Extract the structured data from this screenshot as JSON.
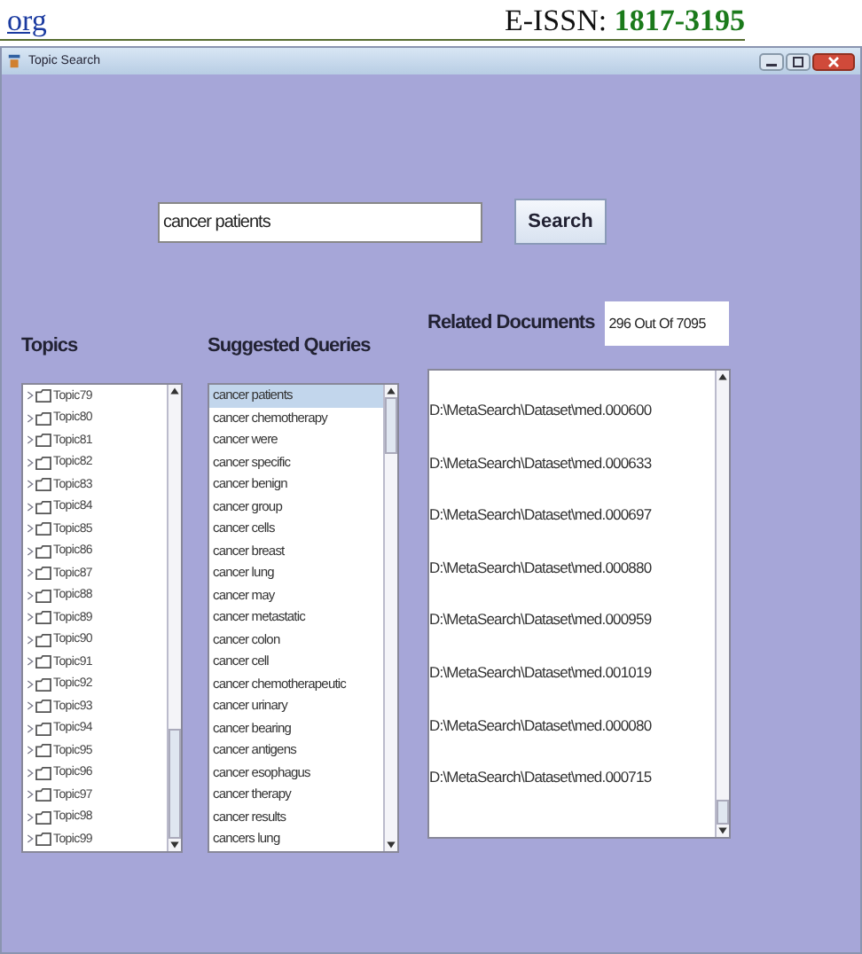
{
  "page_header": {
    "link": "org",
    "issn_label": "E-ISSN: ",
    "issn_number": "1817-3195"
  },
  "window": {
    "title": "Topic Search"
  },
  "search": {
    "value": "cancer patients",
    "button": "Search"
  },
  "topics": {
    "heading": "Topics",
    "items": [
      "Topic79",
      "Topic80",
      "Topic81",
      "Topic82",
      "Topic83",
      "Topic84",
      "Topic85",
      "Topic86",
      "Topic87",
      "Topic88",
      "Topic89",
      "Topic90",
      "Topic91",
      "Topic92",
      "Topic93",
      "Topic94",
      "Topic95",
      "Topic96",
      "Topic97",
      "Topic98",
      "Topic99"
    ]
  },
  "suggested_queries": {
    "heading": "Suggested Queries",
    "items": [
      {
        "text": "cancer patients",
        "selected": true
      },
      {
        "text": "cancer chemotherapy",
        "selected": false
      },
      {
        "text": "cancer were",
        "selected": false
      },
      {
        "text": "cancer specific",
        "selected": false
      },
      {
        "text": "cancer benign",
        "selected": false
      },
      {
        "text": "cancer group",
        "selected": false
      },
      {
        "text": "cancer cells",
        "selected": false
      },
      {
        "text": "cancer breast",
        "selected": false
      },
      {
        "text": "cancer lung",
        "selected": false
      },
      {
        "text": "cancer may",
        "selected": false
      },
      {
        "text": "cancer metastatic",
        "selected": false
      },
      {
        "text": "cancer colon",
        "selected": false
      },
      {
        "text": "cancer cell",
        "selected": false
      },
      {
        "text": "cancer chemotherapeutic",
        "selected": false
      },
      {
        "text": "cancer urinary",
        "selected": false
      },
      {
        "text": "cancer bearing",
        "selected": false
      },
      {
        "text": "cancer antigens",
        "selected": false
      },
      {
        "text": "cancer esophagus",
        "selected": false
      },
      {
        "text": "cancer therapy",
        "selected": false
      },
      {
        "text": "cancer results",
        "selected": false
      },
      {
        "text": "cancers lung",
        "selected": false
      }
    ]
  },
  "related_documents": {
    "heading": "Related Documents",
    "count": "296 Out Of 7095",
    "items": [
      "D:\\MetaSearch\\Dataset\\med.000600",
      "D:\\MetaSearch\\Dataset\\med.000633",
      "D:\\MetaSearch\\Dataset\\med.000697",
      "D:\\MetaSearch\\Dataset\\med.000880",
      "D:\\MetaSearch\\Dataset\\med.000959",
      "D:\\MetaSearch\\Dataset\\med.001019",
      "D:\\MetaSearch\\Dataset\\med.000080",
      "D:\\MetaSearch\\Dataset\\med.000715"
    ]
  }
}
